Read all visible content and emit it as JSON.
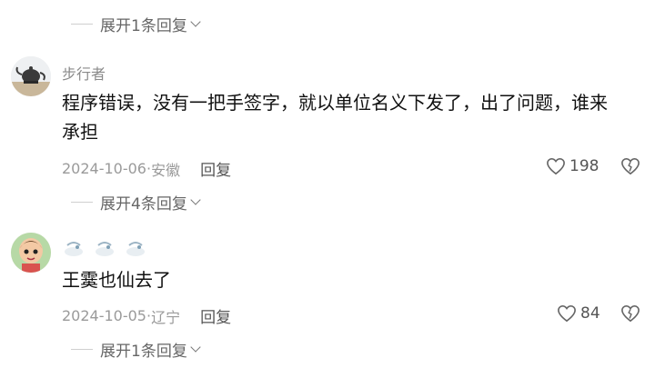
{
  "comments": [
    {
      "username": "步行者",
      "text": "程序错误，没有一把手签字，就以单位名义下发了，出了问题，谁来承担",
      "date": "2024-10-06",
      "location": "安徽",
      "reply_label": "回复",
      "likes": "198",
      "expand_label": "展开4条回复"
    },
    {
      "username_emoji": [
        "drop-emoji",
        "drop-emoji",
        "drop-emoji"
      ],
      "text": "王霙也仙去了",
      "date": "2024-10-05",
      "location": "辽宁",
      "reply_label": "回复",
      "likes": "84",
      "expand_label": "展开1条回复"
    }
  ],
  "top_expand_label": "展开1条回复",
  "separator": " · ",
  "colors": {
    "meta_gray": "#9a9a9a",
    "text": "#111111",
    "link": "#555555"
  }
}
